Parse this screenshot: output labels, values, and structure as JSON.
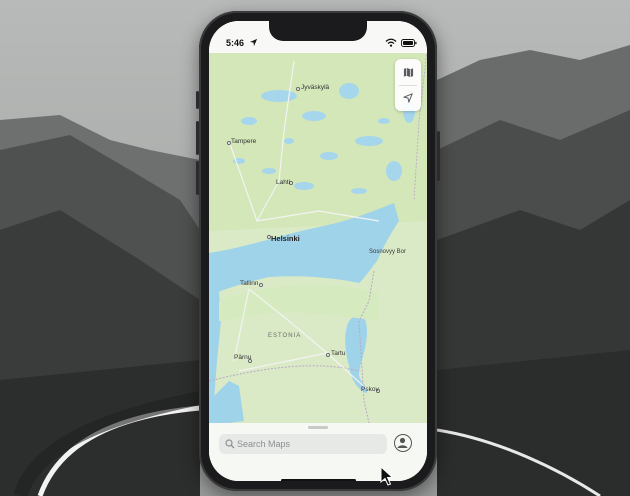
{
  "status_bar": {
    "time": "5:46"
  },
  "map": {
    "labels": {
      "jyvaskyla": "Jyväskylä",
      "tampere": "Tampere",
      "lahti": "Lahti",
      "helsinki": "Helsinki",
      "sosnovy_bor": "Sosnovyy Bor",
      "tallinn": "Tallinn",
      "estonia": "ESTONIA",
      "tartu": "Tartu",
      "parnu": "Pärnu",
      "pskov": "Pskov"
    },
    "colors": {
      "land": "#d9ebc2",
      "water": "#9fd3ea",
      "forest": "#c9e3a8"
    }
  },
  "controls": {
    "map_mode_icon": "map-icon",
    "locate_icon": "location-arrow-icon"
  },
  "search": {
    "placeholder": "Search Maps"
  }
}
